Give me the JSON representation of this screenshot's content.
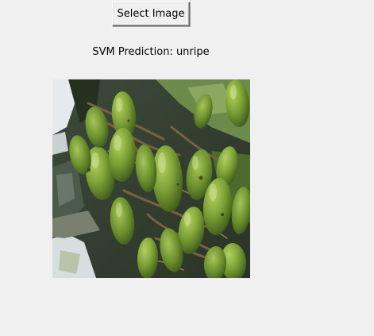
{
  "window": {
    "background": "#f0f0f0"
  },
  "select_button": {
    "label": "Select Image"
  },
  "prediction": {
    "text": "SVM Prediction: unripe"
  },
  "image": {
    "subject": "green unripe mango fruit cluster",
    "palette": {
      "fruit": "#6f9a2e",
      "fruit_highlight": "#9cc24e",
      "fruit_shadow": "#3f5f1c",
      "stem": "#6b5a3a",
      "background": "#556655",
      "sky": "#e8ecef"
    }
  }
}
